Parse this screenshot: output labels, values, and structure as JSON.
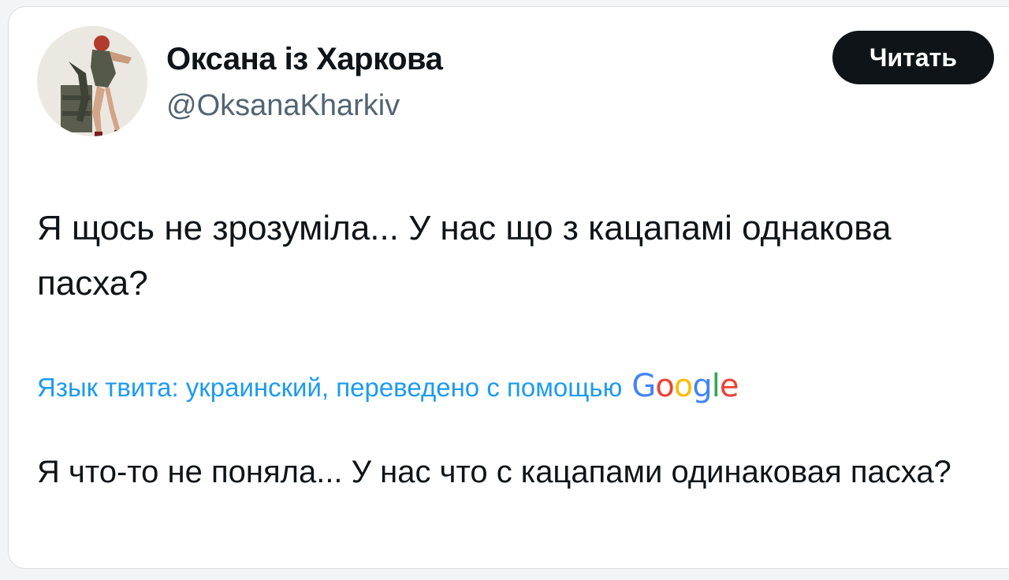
{
  "author": {
    "display_name": "Оксана із Харкова",
    "handle": "@OksanaKharkiv"
  },
  "actions": {
    "read_label": "Читать"
  },
  "tweet": {
    "text": "Я щось не зрозуміла... У нас що з кацапамі однакова пасха?"
  },
  "translation": {
    "label": "Язык твита: украинский, переведено с помощью",
    "provider_letters": [
      "G",
      "o",
      "o",
      "g",
      "l",
      "e"
    ],
    "provider_colors": [
      "#4285f4",
      "#ea4335",
      "#fbbc05",
      "#4285f4",
      "#34a853",
      "#ea4335"
    ],
    "text": "Я что-то не поняла... У нас что с кацапами одинаковая пасха?"
  },
  "colors": {
    "link": "#1d9bf0",
    "text": "#0f1419",
    "secondary": "#536471",
    "button_bg": "#0f1419"
  }
}
